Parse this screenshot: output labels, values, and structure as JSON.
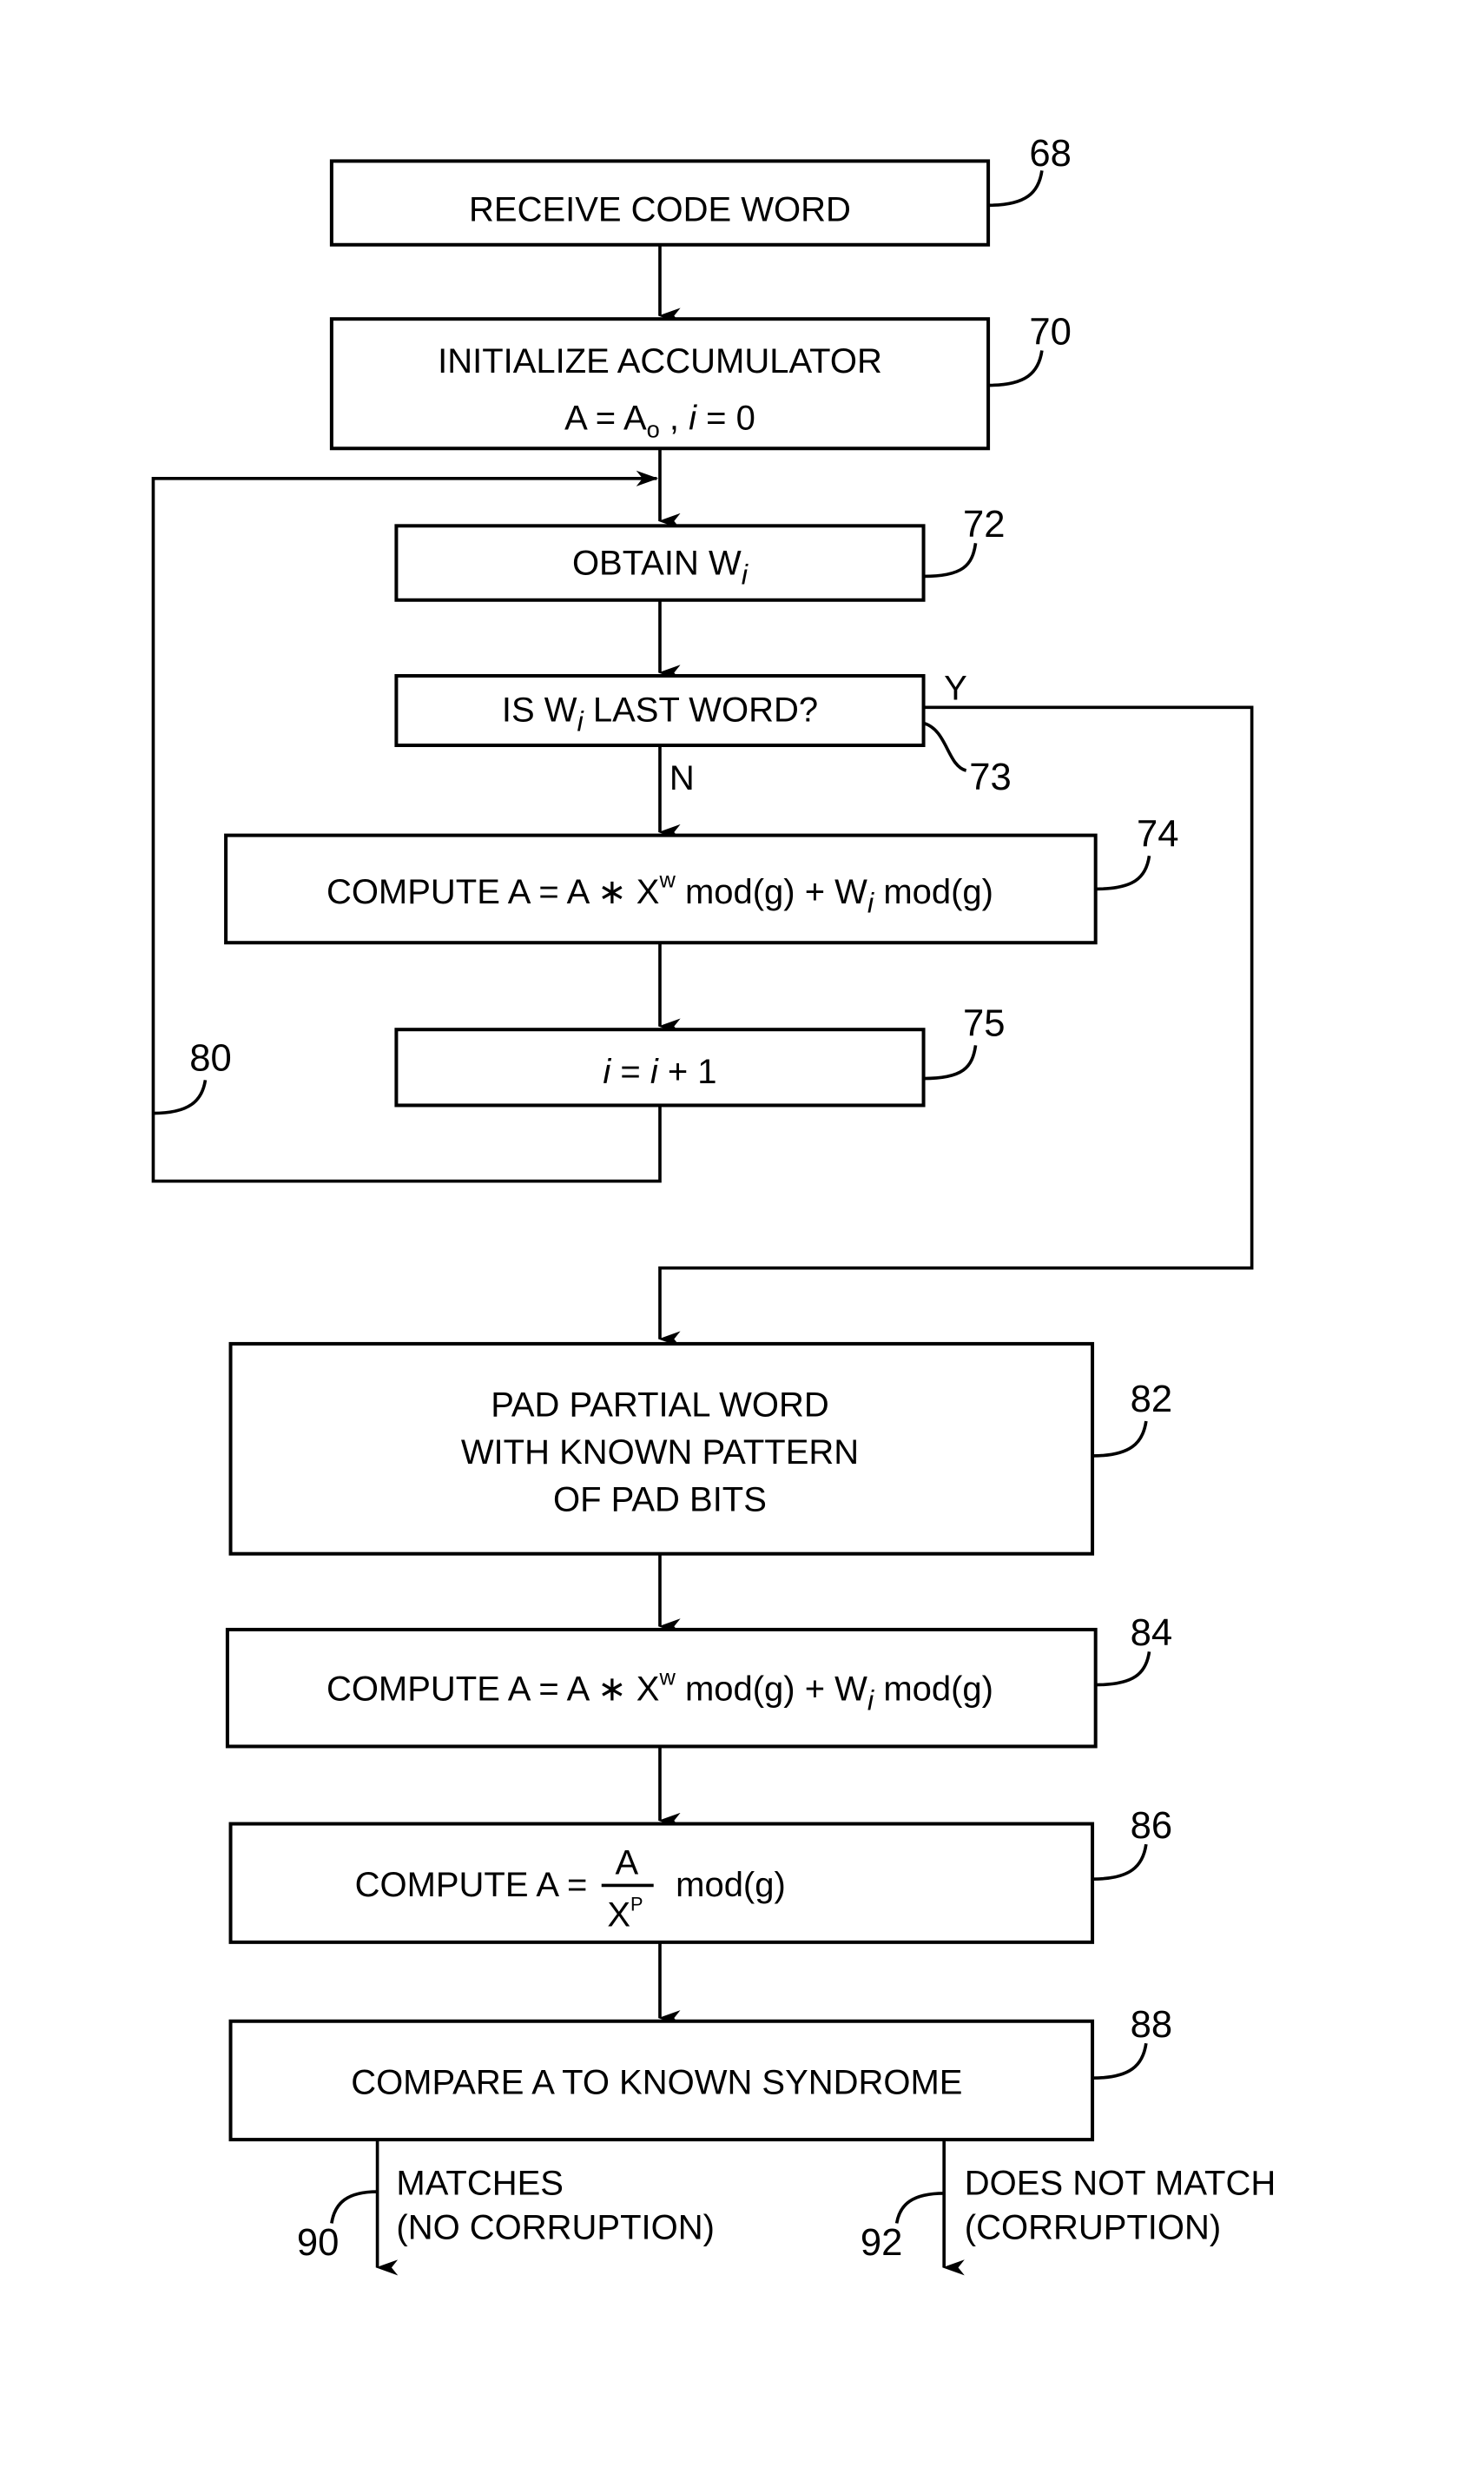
{
  "diagram": {
    "type": "flowchart",
    "steps": {
      "s68": {
        "ref": "68",
        "text": "RECEIVE CODE WORD"
      },
      "s70": {
        "ref": "70",
        "line1": "INITIALIZE ACCUMULATOR",
        "line2_a": "A = A",
        "line2_sub": "o",
        "line2_b": " , ",
        "line2_i": "i",
        "line2_c": " = 0"
      },
      "s72": {
        "ref": "72",
        "text": "OBTAIN W",
        "sub": "i"
      },
      "s73": {
        "ref": "73",
        "text_a": "IS W",
        "sub": "i",
        "text_b": "  LAST WORD?",
        "yes": "Y",
        "no": "N"
      },
      "s74": {
        "ref": "74",
        "a": "COMPUTE A = A ∗ X",
        "sup": "w",
        "b": " mod(g) + W",
        "sub": "i",
        "c": " mod(g)"
      },
      "s75": {
        "ref": "75",
        "i1": "i",
        "mid": " = ",
        "i2": "i",
        "end": " + 1"
      },
      "s80": {
        "ref": "80"
      },
      "s82": {
        "ref": "82",
        "lines": [
          "PAD PARTIAL WORD",
          "WITH KNOWN PATTERN",
          "OF PAD BITS"
        ]
      },
      "s84": {
        "ref": "84",
        "a": "COMPUTE A = A ∗ X",
        "sup": "w",
        "b": " mod(g) + W",
        "sub": "i",
        "c": " mod(g)"
      },
      "s86": {
        "ref": "86",
        "a": "COMPUTE A = ",
        "num": "A",
        "den": "X",
        "den_sup": "P",
        "c": "mod(g)"
      },
      "s88": {
        "ref": "88",
        "text": "COMPARE A TO KNOWN SYNDROME"
      },
      "s90": {
        "ref": "90",
        "line1": "MATCHES",
        "line2": "(NO CORRUPTION)"
      },
      "s92": {
        "ref": "92",
        "line1": "DOES NOT MATCH",
        "line2": "(CORRUPTION)"
      }
    }
  }
}
